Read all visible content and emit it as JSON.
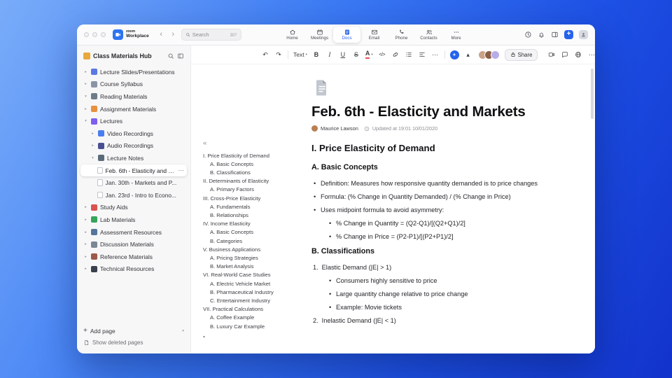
{
  "colors": {
    "accent": "#2563eb",
    "sidebar_bg": "#f7f7f8",
    "window_bg": "#ffffff"
  },
  "titlebar": {
    "logo_line1": "zoom",
    "logo_line2": "Workplace",
    "back": "‹",
    "forward": "›",
    "search": {
      "placeholder": "Search",
      "shortcut": "⌘F"
    },
    "tabs": [
      {
        "label": "Home"
      },
      {
        "label": "Meetings"
      },
      {
        "label": "Docs"
      },
      {
        "label": "Email"
      },
      {
        "label": "Phone"
      },
      {
        "label": "Contacts"
      },
      {
        "label": "More"
      }
    ]
  },
  "sidebar": {
    "title": "Class Materials Hub",
    "title_icon_color": "#e8a93c",
    "items": [
      {
        "chev": "▸",
        "color": "#5b79e3",
        "label": "Lecture Slides/Presentations"
      },
      {
        "chev": "▸",
        "color": "#8a94a6",
        "label": "Course Syllabus"
      },
      {
        "chev": "▾",
        "color": "#6e7b8a",
        "label": "Reading Materials"
      },
      {
        "chev": "▸",
        "color": "#e8913f",
        "label": "Assignment Materials"
      },
      {
        "chev": "▾",
        "color": "#7e5ff0",
        "label": "Lectures"
      },
      {
        "chev": "▸",
        "color": "#4a7df0",
        "label": "Video Recordings"
      },
      {
        "chev": "▸",
        "color": "#4a4f8f",
        "label": "Audio Recordings"
      },
      {
        "chev": "▾",
        "color": "#5b6b7a",
        "label": "Lecture Notes"
      },
      {
        "label": "Feb. 6th - Elasticity and M...",
        "more": "⋯"
      },
      {
        "label": "Jan. 30th - Markets and P..."
      },
      {
        "label": "Jan. 23rd - Intro to Econo..."
      },
      {
        "chev": "▸",
        "color": "#d9534f",
        "label": "Study Aids"
      },
      {
        "chev": "▸",
        "color": "#37a45c",
        "label": "Lab Materials"
      },
      {
        "chev": "▸",
        "color": "#54769c",
        "label": "Assessment Resources"
      },
      {
        "chev": "▸",
        "color": "#7a8794",
        "label": "Discussion Materials"
      },
      {
        "chev": "▸",
        "color": "#9c5b4a",
        "label": "Reference Materials"
      },
      {
        "chev": "▸",
        "color": "#39404e",
        "label": "Technical Resources"
      }
    ],
    "footer": {
      "add_icon": "+",
      "add_label": "Add page",
      "add_chev": "▾",
      "deleted_label": "Show deleted pages"
    }
  },
  "toolbar": {
    "undo": "↶",
    "redo": "↷",
    "text_style": "Text",
    "caret": "▾",
    "bold": "B",
    "italic": "I",
    "underline": "U",
    "strikethrough": "S",
    "color_label": "A",
    "code": "</>",
    "more": "⋯",
    "collapse": "▴",
    "share_label": "Share"
  },
  "outline": {
    "collapse_icon": "«",
    "more_icon": "▾",
    "items": [
      "I. Price Elasticity of Demand",
      "A. Basic Concepts",
      "B. Classifications",
      "II. Determinants of Elasticity",
      "A. Primary Factors",
      "III. Cross-Price Elasticity",
      "A. Fundamentals",
      "B. Relationships",
      "IV. Income Elasticity",
      "A. Basic Concepts",
      "B. Categories",
      "V. Business Applications",
      "A. Pricing Strategies",
      "B. Market Analysis",
      "VI. Real-World Case Studies",
      "A. Electric Vehicle Market",
      "B. Pharmaceutical Industry",
      "C. Entertainment Industry",
      "VII. Practical Calculations",
      "A. Coffee Example",
      "B. Luxury Car Example"
    ]
  },
  "document": {
    "title": "Feb. 6th - Elasticity and Markets",
    "author": "Maurice Lawson",
    "updated": "Updated at 19:01 10/01/2020",
    "section1": "I. Price Elasticity of Demand",
    "sectionA": "A. Basic Concepts",
    "bullets": [
      "Definition: Measures how responsive quantity demanded is to price changes",
      "Formula: (% Change in Quantity Demanded) / (% Change in Price)",
      "Uses midpoint formula to avoid asymmetry:"
    ],
    "subbullets": [
      "% Change in Quantity = (Q2-Q1)/[(Q2+Q1)/2]",
      "% Change in Price = (P2-P1)/[(P2+P1)/2]"
    ],
    "sectionB": "B. Classifications",
    "list": {
      "m1": "1.",
      "t1": "Elastic Demand (|E| > 1)",
      "b1": [
        "Consumers highly sensitive to price",
        "Large quantity change relative to price change",
        "Example: Movie tickets"
      ],
      "m2": "2.",
      "t2": "Inelastic Demand (|E| < 1)"
    }
  }
}
